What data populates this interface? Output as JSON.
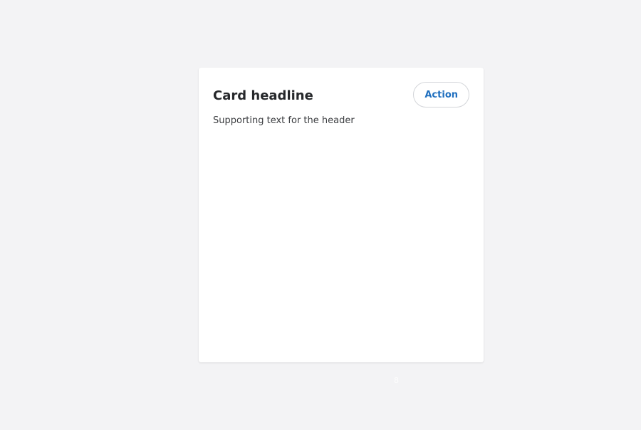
{
  "card": {
    "headline": "Card headline",
    "action_label": "Action",
    "supporting_text": "Supporting text for the header"
  },
  "footer": {
    "marker": "8"
  },
  "colors": {
    "background": "#f3f3f5",
    "card": "#ffffff",
    "accent": "#1f6fbf"
  }
}
